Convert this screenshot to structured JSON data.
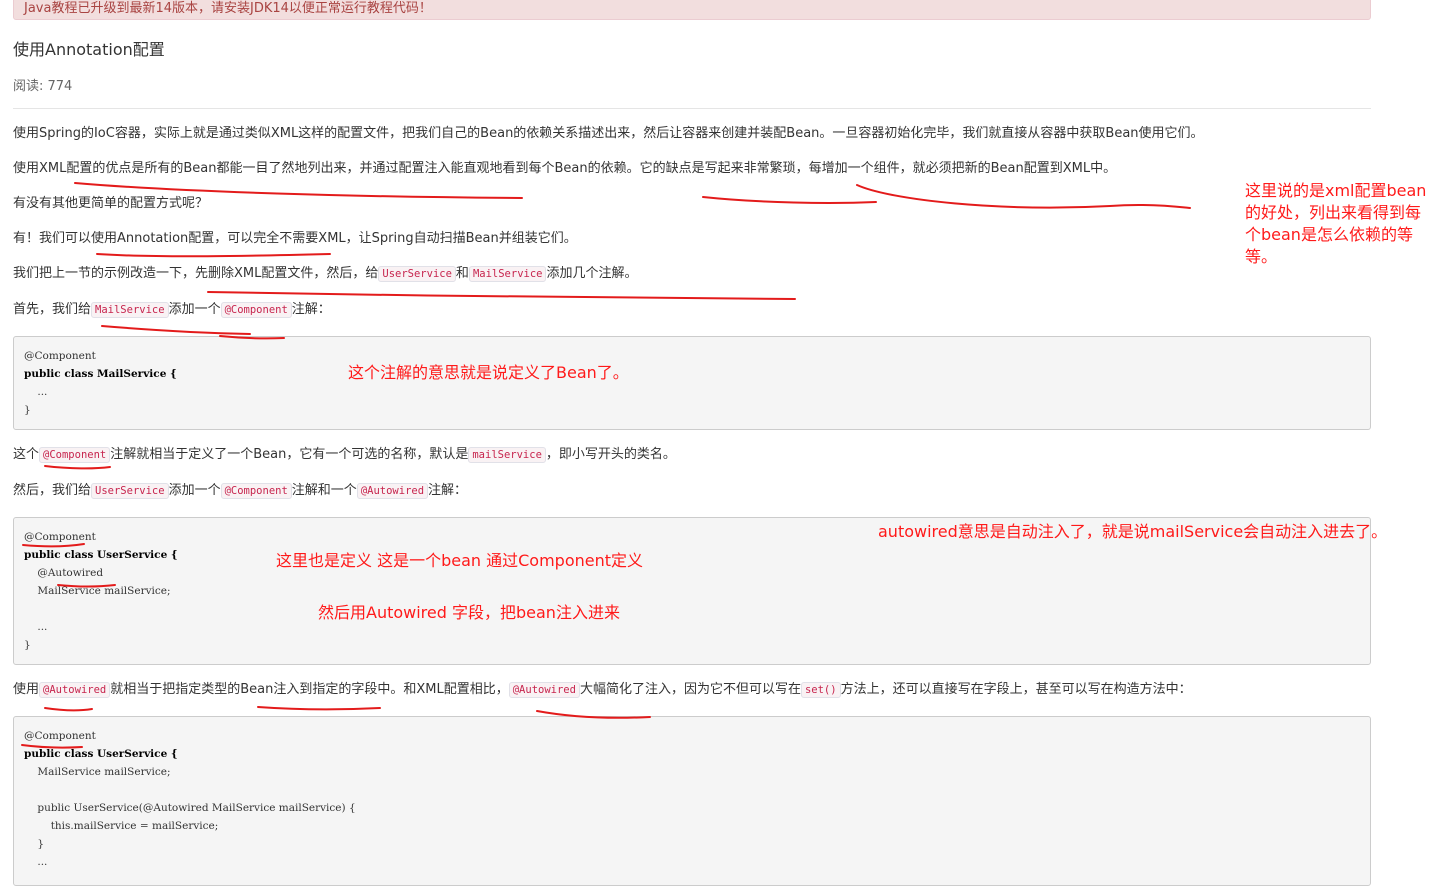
{
  "alert": {
    "text": "Java教程已升级到最新14版本，请安装JDK14以便正常运行教程代码！"
  },
  "article": {
    "title": "使用Annotation配置",
    "reads": "阅读: 774",
    "p1": "使用Spring的IoC容器，实际上就是通过类似XML这样的配置文件，把我们自己的Bean的依赖关系描述出来，然后让容器来创建并装配Bean。一旦容器初始化完毕，我们就直接从容器中获取Bean使用它们。",
    "p2": "使用XML配置的优点是所有的Bean都能一目了然地列出来，并通过配置注入能直观地看到每个Bean的依赖。它的缺点是写起来非常繁琐，每增加一个组件，就必须把新的Bean配置到XML中。",
    "p3": "有没有其他更简单的配置方式呢？",
    "p4": "有！我们可以使用Annotation配置，可以完全不需要XML，让Spring自动扫描Bean并组装它们。",
    "p5": {
      "a": "我们把上一节的示例改造一下，先删除XML配置文件，然后，给",
      "code1": "UserService",
      "b": "和",
      "code2": "MailService",
      "c": "添加几个注解。"
    },
    "p6": {
      "a": "首先，我们给",
      "code1": "MailService",
      "b": "添加一个",
      "code2": "@Component",
      "c": "注解："
    },
    "code1": [
      "@Component",
      "public class MailService {",
      "    ...",
      "}"
    ],
    "p7": {
      "a": "这个",
      "code1": "@Component",
      "b": "注解就相当于定义了一个Bean，它有一个可选的名称，默认是",
      "code2": "mailService",
      "c": "，即小写开头的类名。"
    },
    "p8": {
      "a": "然后，我们给",
      "code1": "UserService",
      "b": "添加一个",
      "code2": "@Component",
      "c": "注解和一个",
      "code3": "@Autowired",
      "d": "注解："
    },
    "code2": [
      "@Component",
      "public class UserService {",
      "    @Autowired",
      "    MailService mailService;",
      "",
      "    ...",
      "}"
    ],
    "p9": {
      "a": "使用",
      "code1": "@Autowired",
      "b": "就相当于把指定类型的Bean注入到指定的字段中。和XML配置相比，",
      "code2": "@Autowired",
      "c": "大幅简化了注入，因为它不但可以写在",
      "code3": "set()",
      "d": "方法上，还可以直接写在字段上，甚至可以写在构造方法中："
    },
    "code3": [
      "@Component",
      "public class UserService {",
      "    MailService mailService;",
      "",
      "    public UserService(@Autowired MailService mailService) {",
      "        this.mailService = mailService;",
      "    }",
      "    ..."
    ]
  },
  "annotations": {
    "a1": [
      "这里说的是xml配置bean",
      "的好处，列出来看得到每",
      "个bean是怎么依赖的等",
      "等。"
    ],
    "a2": "这个注解的意思就是说定义了Bean了。",
    "a3": "autowired意思是自动注入了，就是说mailService会自动注入进去了。",
    "a4": "这里也是定义  这是一个bean  通过Component定义",
    "a5": "然后用Autowired  字段，把bean注入进来",
    "color": "#ff1a1a"
  }
}
